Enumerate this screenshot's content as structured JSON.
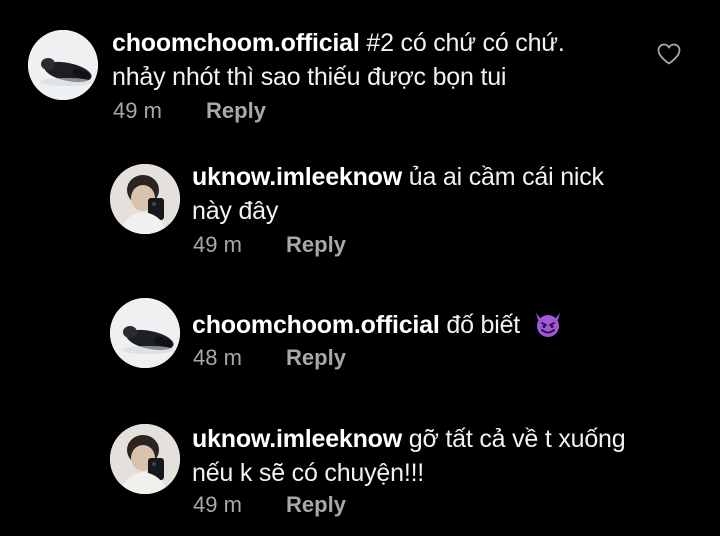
{
  "comments": [
    {
      "username": "choomchoom.official",
      "line1": "#2 có chứ có chứ.",
      "line2": "nhảy nhót thì sao thiếu được bọn tui",
      "time": "49 m",
      "reply": "Reply"
    },
    {
      "username": "uknow.imleeknow",
      "line1": "ủa ai cầm cái nick",
      "line2": "này đây",
      "time": "49 m",
      "reply": "Reply"
    },
    {
      "username": "choomchoom.official",
      "line1": "đố biết",
      "emoji": "smiling-face-with-horns-emoji",
      "time": "48 m",
      "reply": "Reply"
    },
    {
      "username": "uknow.imleeknow",
      "line1": "gỡ tất cả về t xuống",
      "line2": "nếu k sẽ có chuyện!!!",
      "time": "49 m",
      "reply": "Reply"
    }
  ],
  "icons": {
    "like": "heart-icon"
  },
  "colors": {
    "background": "#000000",
    "text": "#f2f2f2",
    "meta": "#a8a8a8",
    "emoji": "#a259d9"
  }
}
